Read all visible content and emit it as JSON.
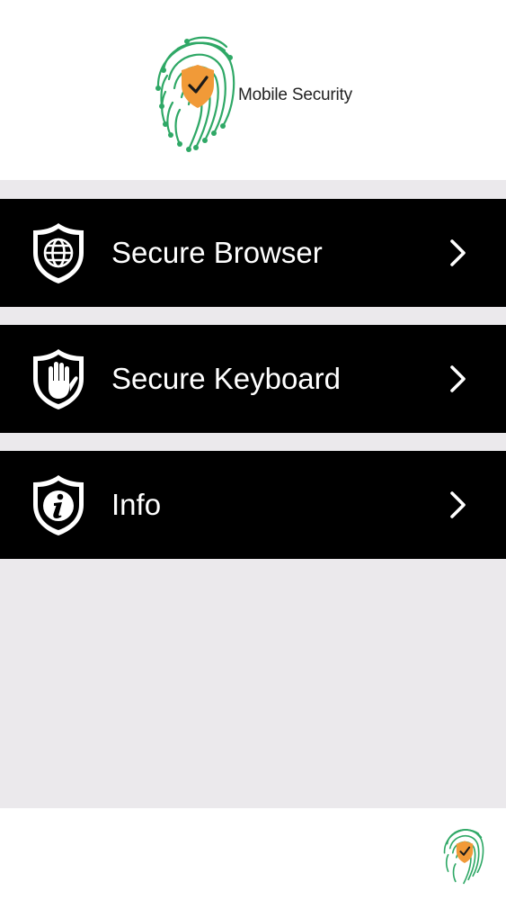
{
  "header": {
    "brand_name": "Mobile Security"
  },
  "menu": {
    "items": [
      {
        "label": "Secure Browser",
        "icon": "shield-globe-icon"
      },
      {
        "label": "Secure Keyboard",
        "icon": "shield-hand-icon"
      },
      {
        "label": "Info",
        "icon": "shield-info-icon"
      }
    ]
  },
  "colors": {
    "menu_background": "#000000",
    "menu_text": "#ffffff",
    "content_background": "#ebe9ec",
    "fingerprint_green": "#2fa866",
    "shield_orange": "#f19a38"
  }
}
